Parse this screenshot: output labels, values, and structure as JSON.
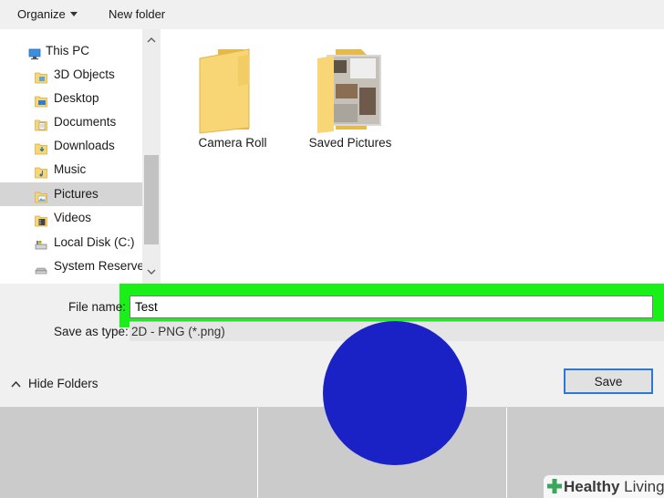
{
  "toolbar": {
    "organize_label": "Organize",
    "new_folder_label": "New folder"
  },
  "nav": {
    "items": [
      {
        "label": "This PC",
        "icon": "pc-icon"
      },
      {
        "label": "3D Objects",
        "icon": "3d-objects-folder-icon"
      },
      {
        "label": "Desktop",
        "icon": "desktop-folder-icon"
      },
      {
        "label": "Documents",
        "icon": "documents-folder-icon"
      },
      {
        "label": "Downloads",
        "icon": "downloads-folder-icon"
      },
      {
        "label": "Music",
        "icon": "music-folder-icon"
      },
      {
        "label": "Pictures",
        "icon": "pictures-folder-icon",
        "selected": true
      },
      {
        "label": "Videos",
        "icon": "videos-folder-icon"
      },
      {
        "label": "Local Disk (C:)",
        "icon": "local-disk-icon"
      },
      {
        "label": "System Reserved",
        "icon": "drive-icon"
      }
    ]
  },
  "content": {
    "folders": [
      {
        "label": "Camera Roll",
        "icon": "folder-icon"
      },
      {
        "label": "Saved Pictures",
        "icon": "folder-with-photo-icon"
      }
    ]
  },
  "form": {
    "file_name_label": "File name:",
    "file_name_value": "Test",
    "save_type_label": "Save as type:",
    "save_type_value": "2D - PNG (*.png)",
    "hide_folders_label": "Hide Folders",
    "save_button_label": "Save"
  },
  "colors": {
    "highlight": "#18f018",
    "folder_yellow": "#f8d675",
    "selected_row": "#d5d5d5",
    "save_border": "#2b78d6",
    "circle_blue": "#1a22c6"
  },
  "watermark": {
    "brand_bold": "Healthy",
    "brand_light": " Living"
  }
}
